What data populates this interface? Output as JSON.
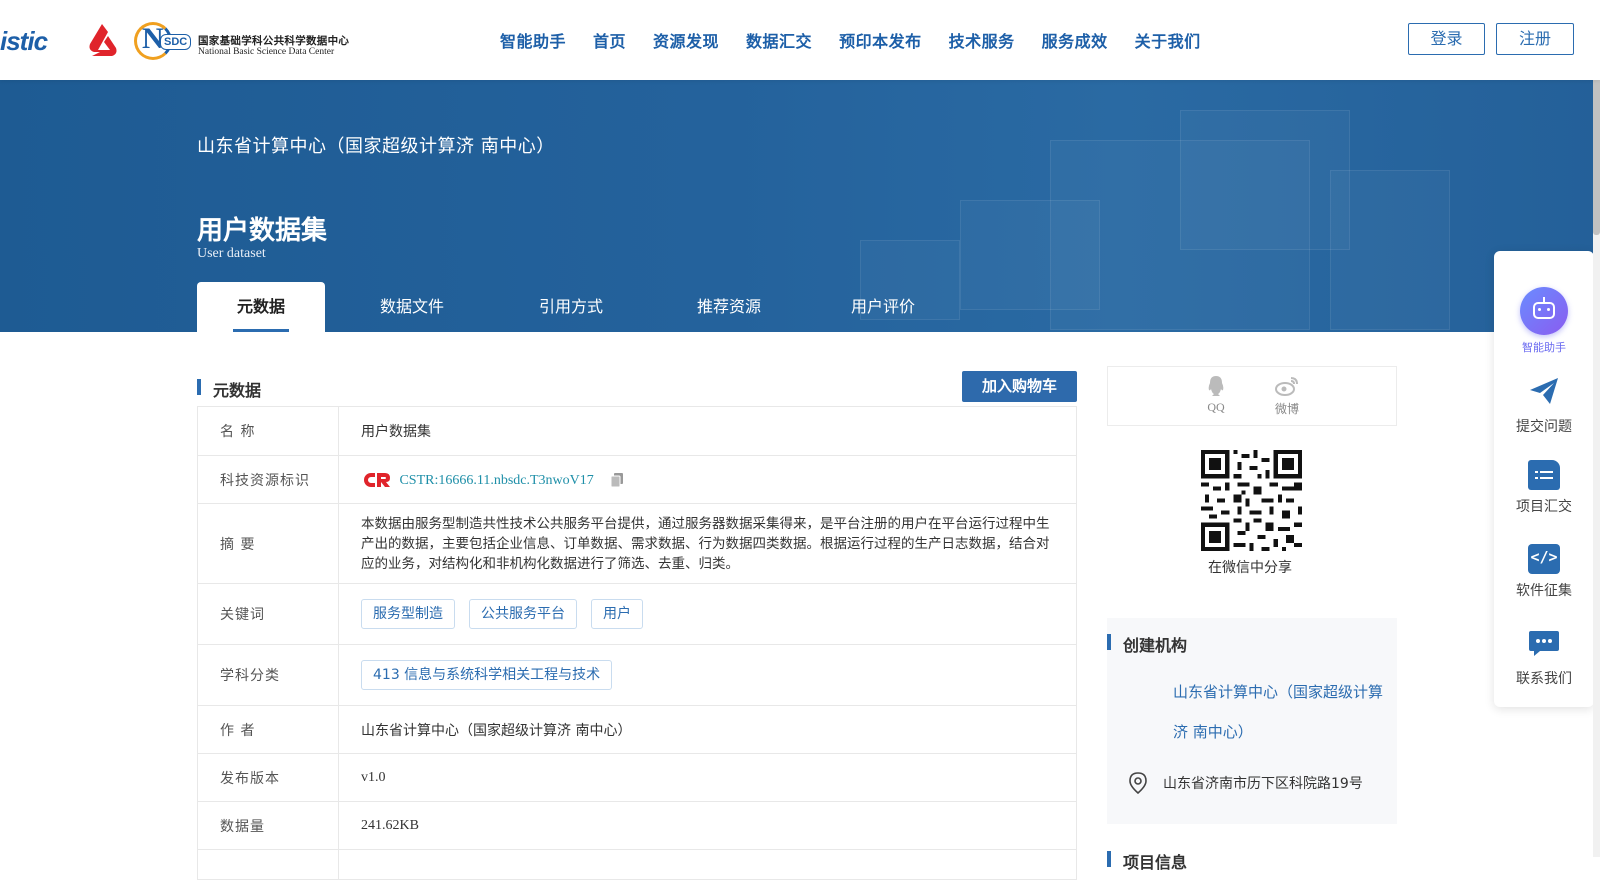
{
  "header": {
    "logo_istic": "istic",
    "logo_nsdc_cn": "国家基础学科公共科学数据中心",
    "logo_nsdc_en": "National Basic Science Data Center",
    "nav": [
      "智能助手",
      "首页",
      "资源发现",
      "数据汇交",
      "预印本发布",
      "技术服务",
      "服务成效",
      "关于我们"
    ],
    "login": "登录",
    "register": "注册"
  },
  "banner": {
    "org": "山东省计算中心（国家超级计算济 南中心）",
    "title": "用户数据集",
    "subtitle": "User dataset",
    "tabs": [
      "元数据",
      "数据文件",
      "引用方式",
      "推荐资源",
      "用户评价"
    ]
  },
  "meta": {
    "section_title": "元数据",
    "cart": "加入购物车",
    "rows": {
      "name_k": "名 称",
      "name_v": "用户数据集",
      "cstr_k": "科技资源标识",
      "cstr_v": "CSTR:16666.11.nbsdc.T3nwoV17",
      "abstract_k": "摘 要",
      "abstract_v": "本数据由服务型制造共性技术公共服务平台提供，通过服务器数据采集得来，是平台注册的用户在平台运行过程中生产出的数据，主要包括企业信息、订单数据、需求数据、行为数据四类数据。根据运行过程的生产日志数据，结合对应的业务，对结构化和非机构化数据进行了筛选、去重、归类。",
      "keywords_k": "关键词",
      "keywords": [
        "服务型制造",
        "公共服务平台",
        "用户"
      ],
      "subject_k": "学科分类",
      "subject_v": "413 信息与系统科学相关工程与技术",
      "author_k": "作 者",
      "author_v": "山东省计算中心（国家超级计算济 南中心）",
      "version_k": "发布版本",
      "version_v": "v1.0",
      "size_k": "数据量",
      "size_v": "241.62KB"
    }
  },
  "share": {
    "qq": "QQ",
    "weibo": "微博",
    "wechat": "在微信中分享"
  },
  "creator": {
    "section_title": "创建机构",
    "org": "山东省计算中心（国家超级计算济 南中心）",
    "address": "山东省济南市历下区科院路19号"
  },
  "project": {
    "section_title": "项目信息"
  },
  "float_bar": {
    "assistant": "智能助手",
    "submit": "提交问题",
    "project": "项目汇交",
    "software": "软件征集",
    "contact": "联系我们"
  },
  "colors": {
    "primary": "#2b6cb0",
    "banner": "#1e5b93",
    "cstr": "#1e8fa8"
  }
}
